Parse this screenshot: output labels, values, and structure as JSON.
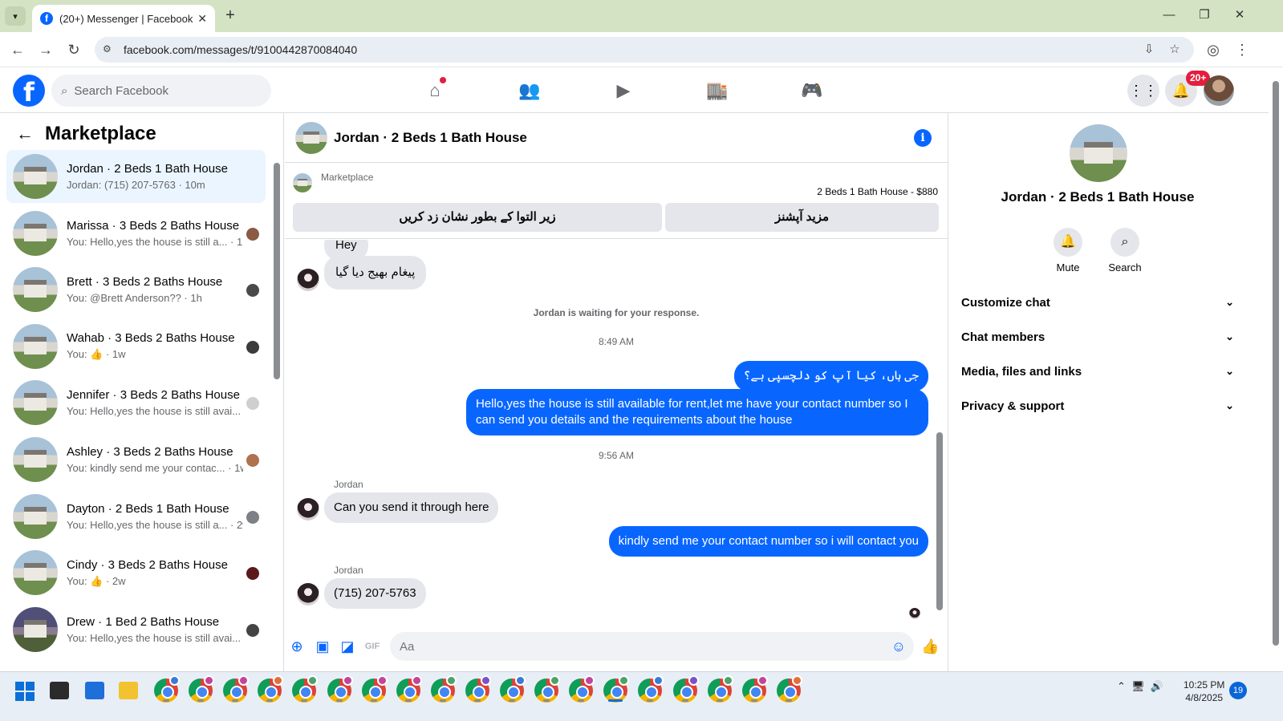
{
  "browser": {
    "tab_title": "(20+) Messenger | Facebook",
    "url": "facebook.com/messages/t/9100442870084040"
  },
  "fb": {
    "search_placeholder": "Search Facebook",
    "notif_badge": "20+"
  },
  "left": {
    "title": "Marketplace",
    "conversations": [
      {
        "name": "Jordan · 2 Beds 1 Bath House",
        "preview": "Jordan: (715) 207-5763 · 10m",
        "active": true
      },
      {
        "name": "Marissa · 3 Beds 2 Baths House",
        "preview": "You: Hello,yes the house is still a... · 1h"
      },
      {
        "name": "Brett · 3 Beds 2 Baths House",
        "preview": "You: @Brett Anderson?? · 1h"
      },
      {
        "name": "Wahab · 3 Beds 2 Baths House",
        "preview": "You: 👍 · 1w"
      },
      {
        "name": "Jennifer · 3 Beds 2 Baths House",
        "preview": "You: Hello,yes the house is still avai... · 1w"
      },
      {
        "name": "Ashley · 3 Beds 2 Baths House",
        "preview": "You: kindly send me your contac... · 1w"
      },
      {
        "name": "Dayton · 2 Beds 1 Bath House",
        "preview": "You: Hello,yes the house is still a... · 2w"
      },
      {
        "name": "Cindy · 3 Beds 2 Baths House",
        "preview": "You: 👍 · 2w"
      },
      {
        "name": "Drew · 1 Bed 2 Baths House",
        "preview": "You: Hello,yes the house is still avai... · 2w"
      }
    ]
  },
  "chat": {
    "title": "Jordan · 2 Beds 1 Bath House",
    "marketplace_label": "Marketplace",
    "listing": "2 Beds 1 Bath House - $880",
    "btn_pending": "زیر التوا کے بطور نشان زد کریں",
    "btn_more": "مزید آپشنز",
    "msg_hey": "Hey",
    "msg_sent": "پیغام بھیج دیا گیا",
    "waiting": "Jordan is waiting for your response.",
    "time1": "8:49 AM",
    "msg_out1": "جی ہاں، کیا آپ کو دلچسپی ہے؟",
    "msg_out2": "Hello,yes the house is still available for rent,let me have your contact number  so I can send you details and the requirements about the house",
    "time2": "9:56 AM",
    "sender": "Jordan",
    "msg_in1": "Can you send it through here",
    "msg_out3": "kindly send me your contact number so i will contact you",
    "msg_in2": "(715) 207-5763",
    "composer_placeholder": "Aa"
  },
  "right": {
    "name": "Jordan · 2 Beds 1 Bath House",
    "mute": "Mute",
    "search": "Search",
    "sections": [
      "Customize chat",
      "Chat members",
      "Media, files and links",
      "Privacy & support"
    ]
  },
  "taskbar": {
    "time": "10:25 PM",
    "date": "4/8/2025",
    "badge": "19"
  }
}
